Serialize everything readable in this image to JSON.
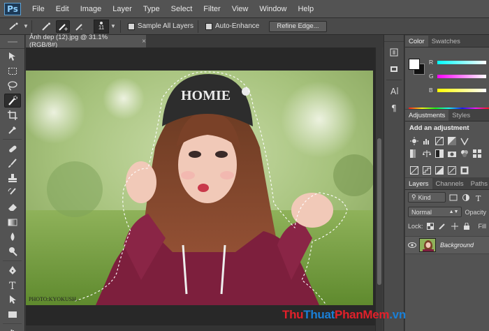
{
  "app": {
    "logo": "Ps"
  },
  "menu": [
    "File",
    "Edit",
    "Image",
    "Layer",
    "Type",
    "Select",
    "Filter",
    "View",
    "Window",
    "Help"
  ],
  "options": {
    "brush_size": "11",
    "sample_all_layers": "Sample All Layers",
    "auto_enhance": "Auto-Enhance",
    "refine_edge": "Refine Edge..."
  },
  "document": {
    "tab_title": "Ảnh dep (12).jpg @ 31.1% (RGB/8#)",
    "close_glyph": "×",
    "photo_credit": "PHOTO:KYOKUSH..."
  },
  "color_panel": {
    "tabs": [
      "Color",
      "Swatches"
    ],
    "sliders": [
      {
        "label": "R",
        "color_start": "#00ffff",
        "color_end": "#ffffff"
      },
      {
        "label": "G",
        "color_start": "#ff00ff",
        "color_end": "#ffffff"
      },
      {
        "label": "B",
        "color_start": "#ffff00",
        "color_end": "#ffffff"
      }
    ]
  },
  "adjustments_panel": {
    "tabs": [
      "Adjustments",
      "Styles"
    ],
    "heading": "Add an adjustment"
  },
  "layers_panel": {
    "tabs": [
      "Layers",
      "Channels",
      "Paths"
    ],
    "filter_kind": "Kind",
    "blend_mode": "Normal",
    "opacity_label": "Opacity",
    "lock_label": "Lock:",
    "fill_label": "Fill",
    "layer_name": "Background"
  },
  "watermark": {
    "part1": "Thu",
    "part2": "Thuat",
    "part3": "PhanMem",
    "part4": ".vn",
    "color_red": "#e2202a",
    "color_blue": "#1a7fd6"
  }
}
